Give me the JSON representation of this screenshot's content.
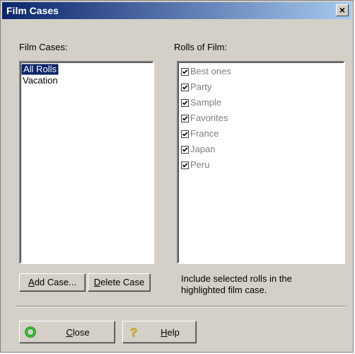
{
  "window": {
    "title": "Film Cases",
    "close_label": "×"
  },
  "film_cases": {
    "label": "Film Cases:",
    "items": [
      "All Rolls",
      "Vacation"
    ],
    "selected_index": 0
  },
  "rolls": {
    "label": "Rolls of Film:",
    "items": [
      {
        "label": "Best ones",
        "checked": true
      },
      {
        "label": "Party",
        "checked": true
      },
      {
        "label": "Sample",
        "checked": true
      },
      {
        "label": "Favorites",
        "checked": true
      },
      {
        "label": "France",
        "checked": true
      },
      {
        "label": "Japan",
        "checked": true
      },
      {
        "label": "Peru",
        "checked": true
      }
    ]
  },
  "buttons": {
    "add_case_mnemonic": "A",
    "add_case_rest": "dd Case...",
    "delete_case_mnemonic": "D",
    "delete_case_rest": "elete Case",
    "close_mnemonic": "C",
    "close_rest": "lose",
    "help_mnemonic": "H",
    "help_rest": "elp"
  },
  "info": {
    "line1": "Include selected rolls in the",
    "line2": "highlighted film case."
  },
  "icons": {
    "close": "green-ring-icon",
    "help": "yellow-question-icon"
  },
  "colors": {
    "title_start": "#0a246a",
    "title_end": "#a6caf0",
    "face": "#d4d0c8",
    "selection": "#0a246a"
  }
}
